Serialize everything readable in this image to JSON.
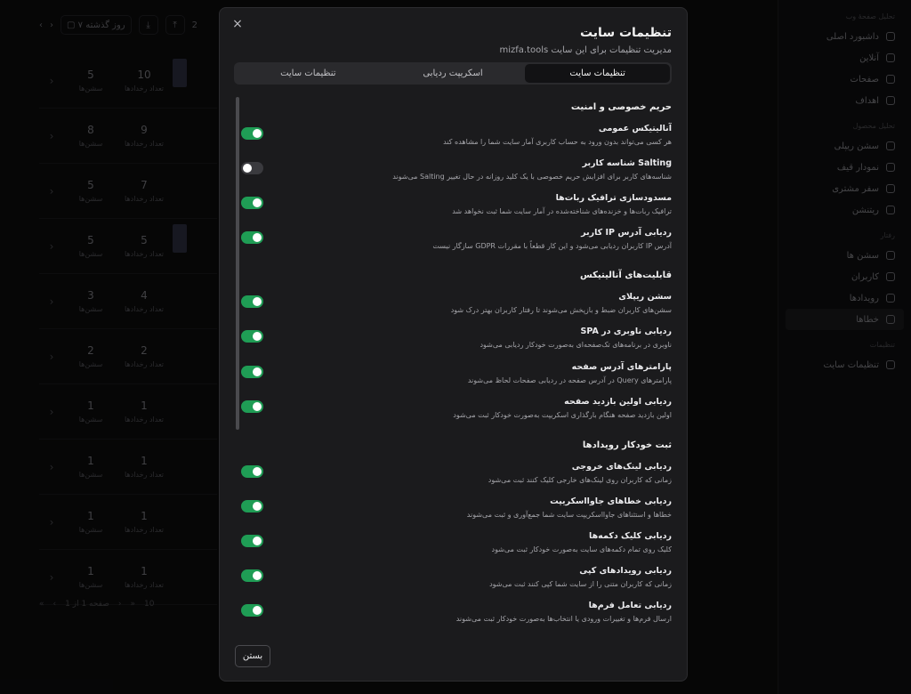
{
  "background": {
    "sidebar": {
      "groups": [
        {
          "title": "تحلیل صفحهٔ وب",
          "items": [
            "داشبورد اصلی",
            "آنلاین",
            "صفحات",
            "اهداف"
          ]
        },
        {
          "title": "تحلیل محصول",
          "items": [
            "سشن ریپلی",
            "نمودار قیف",
            "سفر مشتری",
            "ریتنشن"
          ]
        },
        {
          "title": "رفتار",
          "items": [
            "سشن ها",
            "کاربران",
            "رویدادها",
            "خطاها"
          ]
        },
        {
          "title": "تنظیمات",
          "items": [
            "تنظیمات سایت"
          ]
        }
      ],
      "active_item": "خطاها"
    },
    "toolbar": {
      "range_label": "۷ روز گذشته",
      "page_num": "2"
    },
    "table_rows": [
      {
        "events": "10",
        "sessions": "5",
        "events_label": "تعداد رخدادها",
        "sessions_label": "سشن‌ها"
      },
      {
        "events": "9",
        "sessions": "8",
        "events_label": "تعداد رخدادها",
        "sessions_label": "سشن‌ها"
      },
      {
        "events": "7",
        "sessions": "5",
        "events_label": "تعداد رخدادها",
        "sessions_label": "سشن‌ها"
      },
      {
        "events": "5",
        "sessions": "5",
        "events_label": "تعداد رخدادها",
        "sessions_label": "سشن‌ها"
      },
      {
        "events": "4",
        "sessions": "3",
        "events_label": "تعداد رخدادها",
        "sessions_label": "سشن‌ها"
      },
      {
        "events": "2",
        "sessions": "2",
        "events_label": "تعداد رخدادها",
        "sessions_label": "سشن‌ها"
      },
      {
        "events": "1",
        "sessions": "1",
        "events_label": "تعداد رخدادها",
        "sessions_label": "سشن‌ها"
      },
      {
        "events": "1",
        "sessions": "1",
        "events_label": "تعداد رخدادها",
        "sessions_label": "سشن‌ها"
      },
      {
        "events": "1",
        "sessions": "1",
        "events_label": "تعداد رخدادها",
        "sessions_label": "سشن‌ها"
      },
      {
        "events": "1",
        "sessions": "1",
        "events_label": "تعداد رخدادها",
        "sessions_label": "سشن‌ها"
      }
    ],
    "pager": {
      "label": "صفحه 1 از 1",
      "page_size": "10"
    }
  },
  "modal": {
    "title": "تنظیمات سایت",
    "subtitle": "مدیریت تنظیمات برای این سایت mizfa.tools",
    "close_icon": "×",
    "tabs": [
      {
        "label": "تنظیمات سایت",
        "active": true
      },
      {
        "label": "اسکریپت ردیابی",
        "active": false
      },
      {
        "label": "تنظیمات سایت",
        "active": false
      }
    ],
    "sections": [
      {
        "title": "حریم خصوصی و امنیت",
        "settings": [
          {
            "title": "آنالیتیکس عمومی",
            "desc": "هر کسی می‌تواند بدون ورود به حساب کاربری آمار سایت شما را مشاهده کند",
            "enabled": true
          },
          {
            "title": "Salting شناسه کاربر",
            "desc": "شناسه‌های کاربر برای افزایش حریم خصوصی با یک کلید روزانه در حال تغییر Salting می‌شوند",
            "enabled": false
          },
          {
            "title": "مسدودسازی ترافیک ربات‌ها",
            "desc": "ترافیک ربات‌ها و خزنده‌های شناخته‌شده در آمار سایت شما ثبت نخواهد شد",
            "enabled": true
          },
          {
            "title": "ردیابی آدرس IP کاربر",
            "desc": "آدرس IP کاربران ردیابی می‌شود و این کار قطعاً با مقررات GDPR سازگار نیست",
            "enabled": true
          }
        ]
      },
      {
        "title": "قابلیت‌های آنالیتیکس",
        "settings": [
          {
            "title": "سشن ریپلای",
            "desc": "سشن‌های کاربران ضبط و بازپخش می‌شوند تا رفتار کاربران بهتر درک شود",
            "enabled": true
          },
          {
            "title": "ردیابی ناوبری در SPA",
            "desc": "ناوبری در برنامه‌های تک‌صفحه‌ای به‌صورت خودکار ردیابی می‌شود",
            "enabled": true
          },
          {
            "title": "پارامترهای آدرس صفحه",
            "desc": "پارامترهای Query در آدرس صفحه در ردیابی صفحات لحاظ می‌شوند",
            "enabled": true
          },
          {
            "title": "ردیابی اولین بازدید صفحه",
            "desc": "اولین بازدید صفحه هنگام بارگذاری اسکریپت به‌صورت خودکار ثبت می‌شود",
            "enabled": true
          }
        ]
      },
      {
        "title": "ثبت خودکار رویدادها",
        "settings": [
          {
            "title": "ردیابی لینک‌های خروجی",
            "desc": "زمانی که کاربران روی لینک‌های خارجی کلیک کنند ثبت می‌شود",
            "enabled": true
          },
          {
            "title": "ردیابی خطاهای جاوااسکریپت",
            "desc": "خطاها و استثناهای جاوااسکریپت سایت شما جمع‌آوری و ثبت می‌شوند",
            "enabled": true
          },
          {
            "title": "ردیابی کلیک دکمه‌ها",
            "desc": "کلیک روی تمام دکمه‌های سایت به‌صورت خودکار ثبت می‌شود",
            "enabled": true
          },
          {
            "title": "ردیابی رویدادهای کپی",
            "desc": "زمانی که کاربران متنی را از سایت شما کپی کنند ثبت می‌شود",
            "enabled": true
          },
          {
            "title": "ردیابی تعامل فرم‌ها",
            "desc": "ارسال فرم‌ها و تغییرات ورودی یا انتخاب‌ها به‌صورت خودکار ثبت می‌شوند",
            "enabled": true
          }
        ]
      }
    ],
    "close_button_label": "بستن",
    "colors": {
      "toggle_on": "#1f9d55",
      "toggle_off": "#3a3a3e",
      "surface": "#1b1b1d"
    }
  }
}
